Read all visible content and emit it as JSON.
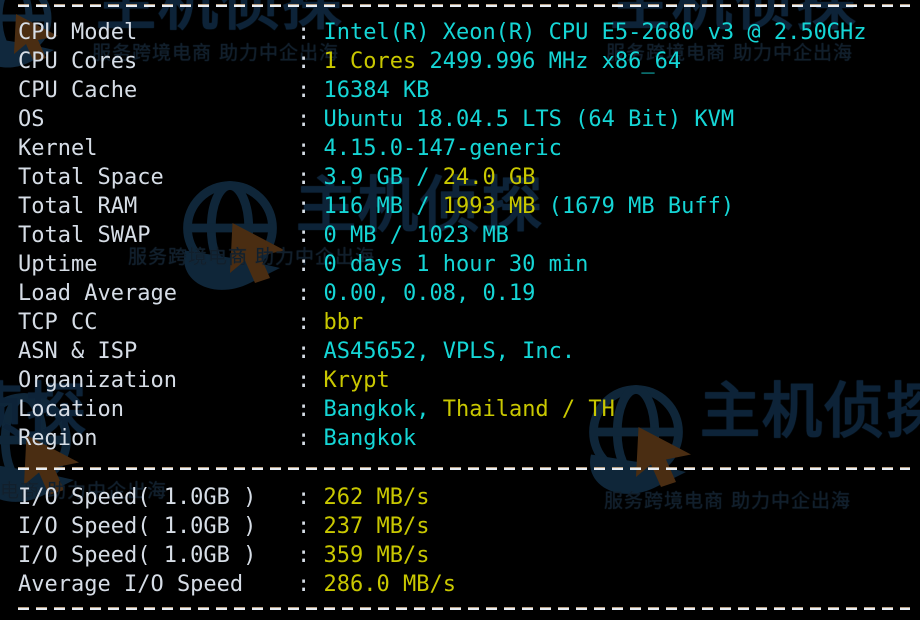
{
  "terminal": {
    "background_color": "#000000",
    "label_color": "#d6dde6",
    "value_cyan": "#15d6d6",
    "value_yellow": "#c9c800",
    "separator_color": "#e8eef5"
  },
  "system_info": {
    "rows": [
      {
        "label": "CPU Model",
        "cyan_1": "Intel(R) Xeon(R) CPU E5-2680 v3 @ 2.50GHz",
        "yellow": "",
        "cyan_2": ""
      },
      {
        "label": "CPU Cores",
        "cyan_1": "",
        "yellow": "1 Cores",
        "cyan_2": " 2499.996 MHz x86_64"
      },
      {
        "label": "CPU Cache",
        "cyan_1": "16384 KB",
        "yellow": "",
        "cyan_2": ""
      },
      {
        "label": "OS",
        "cyan_1": "Ubuntu 18.04.5 LTS (64 Bit) KVM",
        "yellow": "",
        "cyan_2": ""
      },
      {
        "label": "Kernel",
        "cyan_1": "4.15.0-147-generic",
        "yellow": "",
        "cyan_2": ""
      },
      {
        "label": "Total Space",
        "cyan_1": "3.9 GB / ",
        "yellow": "24.0 GB",
        "cyan_2": ""
      },
      {
        "label": "Total RAM",
        "cyan_1": "116 MB / ",
        "yellow": "1993 MB",
        "cyan_2": " (1679 MB Buff)"
      },
      {
        "label": "Total SWAP",
        "cyan_1": "0 MB / 1023 MB",
        "yellow": "",
        "cyan_2": ""
      },
      {
        "label": "Uptime",
        "cyan_1": "0 days 1 hour 30 min",
        "yellow": "",
        "cyan_2": ""
      },
      {
        "label": "Load Average",
        "cyan_1": "0.00, 0.08, 0.19",
        "yellow": "",
        "cyan_2": ""
      },
      {
        "label": "TCP CC",
        "cyan_1": "",
        "yellow": "bbr",
        "cyan_2": ""
      },
      {
        "label": "ASN & ISP",
        "cyan_1": "AS45652, VPLS, Inc.",
        "yellow": "",
        "cyan_2": ""
      },
      {
        "label": "Organization",
        "cyan_1": "",
        "yellow": "Krypt",
        "cyan_2": ""
      },
      {
        "label": "Location",
        "cyan_1": "Bangkok, ",
        "yellow": "Thailand / TH",
        "cyan_2": ""
      },
      {
        "label": "Region",
        "cyan_1": "Bangkok",
        "yellow": "",
        "cyan_2": ""
      }
    ]
  },
  "io_results": {
    "rows": [
      {
        "label": "I/O Speed( 1.0GB )",
        "cyan_1": "",
        "yellow": "262 MB/s",
        "cyan_2": ""
      },
      {
        "label": "I/O Speed( 1.0GB )",
        "cyan_1": "",
        "yellow": "237 MB/s",
        "cyan_2": ""
      },
      {
        "label": "I/O Speed( 1.0GB )",
        "cyan_1": "",
        "yellow": "359 MB/s",
        "cyan_2": ""
      },
      {
        "label": "Average I/O Speed",
        "cyan_1": "",
        "yellow": "286.0 MB/s",
        "cyan_2": ""
      }
    ]
  },
  "colon": ":",
  "watermark": {
    "brand_text": "主机侦探",
    "tagline_text": "服务跨境电商 助力中企出海",
    "logo_name": "globe-cursor-logo",
    "color": "#0d2338"
  }
}
